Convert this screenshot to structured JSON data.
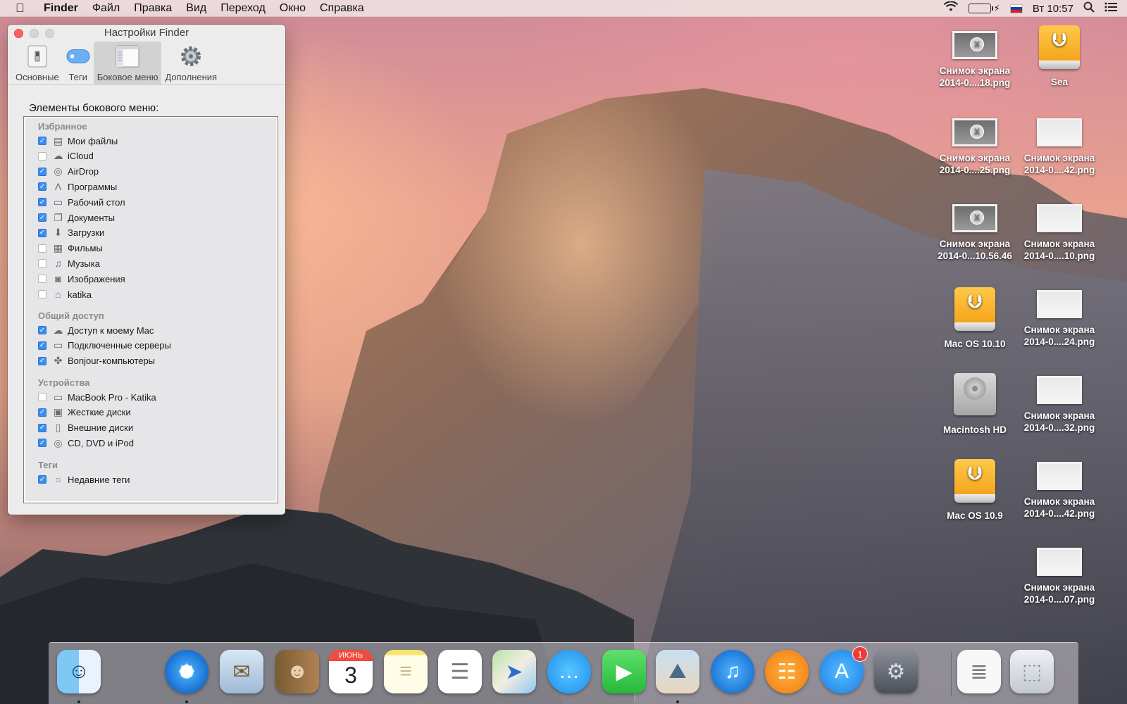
{
  "menubar": {
    "apple_icon": "apple-logo-icon",
    "app_name": "Finder",
    "items": [
      "Файл",
      "Правка",
      "Вид",
      "Переход",
      "Окно",
      "Справка"
    ],
    "clock": "Вт 10:57",
    "battery_level": 0.8,
    "status_icons": [
      "wifi-icon",
      "battery-icon",
      "language-flag-icon",
      "spotlight-icon",
      "notification-center-icon"
    ]
  },
  "prefs_window": {
    "title": "Настройки Finder",
    "tabs": [
      {
        "label": "Основные",
        "icon": "switch-icon"
      },
      {
        "label": "Теги",
        "icon": "tag-icon"
      },
      {
        "label": "Боковое меню",
        "icon": "sidebar-icon"
      },
      {
        "label": "Дополнения",
        "icon": "gear-icon"
      }
    ],
    "active_tab": "Боковое меню",
    "section_title": "Элементы бокового меню:",
    "groups": [
      {
        "header": "Избранное",
        "items": [
          {
            "label": "Мои файлы",
            "checked": true,
            "icon": "all-files-icon"
          },
          {
            "label": "iCloud",
            "checked": false,
            "icon": "cloud-icon"
          },
          {
            "label": "AirDrop",
            "checked": true,
            "icon": "airdrop-icon"
          },
          {
            "label": "Программы",
            "checked": true,
            "icon": "applications-icon"
          },
          {
            "label": "Рабочий стол",
            "checked": true,
            "icon": "desktop-icon"
          },
          {
            "label": "Документы",
            "checked": true,
            "icon": "documents-icon"
          },
          {
            "label": "Загрузки",
            "checked": true,
            "icon": "downloads-icon"
          },
          {
            "label": "Фильмы",
            "checked": false,
            "icon": "movies-icon"
          },
          {
            "label": "Музыка",
            "checked": false,
            "icon": "music-icon"
          },
          {
            "label": "Изображения",
            "checked": false,
            "icon": "camera-icon"
          },
          {
            "label": "katika",
            "checked": false,
            "icon": "home-icon"
          }
        ]
      },
      {
        "header": "Общий доступ",
        "items": [
          {
            "label": "Доступ к моему Mac",
            "checked": true,
            "icon": "cloud-icon"
          },
          {
            "label": "Подключенные серверы",
            "checked": true,
            "icon": "server-icon"
          },
          {
            "label": "Bonjour-компьютеры",
            "checked": true,
            "icon": "bonjour-icon"
          }
        ]
      },
      {
        "header": "Устройства",
        "items": [
          {
            "label": "MacBook Pro - Katika",
            "checked": false,
            "icon": "laptop-icon"
          },
          {
            "label": "Жесткие диски",
            "checked": true,
            "icon": "hard-disk-icon"
          },
          {
            "label": "Внешние диски",
            "checked": true,
            "icon": "external-disk-icon"
          },
          {
            "label": "CD, DVD и iPod",
            "checked": true,
            "icon": "optical-disc-icon"
          }
        ]
      },
      {
        "header": "Теги",
        "items": [
          {
            "label": "Недавние теги",
            "checked": true,
            "icon": "tag-circle-icon"
          }
        ]
      }
    ]
  },
  "desktop_icons": [
    {
      "line1": "Снимок экрана",
      "line2": "2014-0....18.png",
      "kind": "screenshot"
    },
    {
      "line1": "Sea",
      "line2": "",
      "kind": "usb-drive"
    },
    {
      "line1": "Снимок экрана",
      "line2": "2014-0....25.png",
      "kind": "screenshot"
    },
    {
      "line1": "Снимок экрана",
      "line2": "2014-0....42.png",
      "kind": "screenshot"
    },
    {
      "line1": "Снимок экрана",
      "line2": "2014-0...10.56.46",
      "kind": "screenshot"
    },
    {
      "line1": "Снимок экрана",
      "line2": "2014-0....10.png",
      "kind": "screenshot"
    },
    {
      "line1": "Mac OS 10.10",
      "line2": "",
      "kind": "usb-drive"
    },
    {
      "line1": "Снимок экрана",
      "line2": "2014-0....24.png",
      "kind": "screenshot"
    },
    {
      "line1": "Macintosh HD",
      "line2": "",
      "kind": "hard-disk"
    },
    {
      "line1": "Снимок экрана",
      "line2": "2014-0....32.png",
      "kind": "screenshot"
    },
    {
      "line1": "Mac OS 10.9",
      "line2": "",
      "kind": "usb-drive"
    },
    {
      "line1": "Снимок экрана",
      "line2": "2014-0....42.png",
      "kind": "screenshot"
    },
    {
      "line1": "Снимок экрана",
      "line2": "2014-0....07.png",
      "kind": "screenshot"
    }
  ],
  "dock": {
    "apps": [
      {
        "name": "finder-icon",
        "running": true
      },
      {
        "name": "safari-icon",
        "running": true
      },
      {
        "name": "mail-icon",
        "running": false
      },
      {
        "name": "contacts-icon",
        "running": false
      },
      {
        "name": "calendar-icon",
        "running": false,
        "month": "ИЮНЬ",
        "day": "3"
      },
      {
        "name": "notes-icon",
        "running": false
      },
      {
        "name": "reminders-icon",
        "running": false
      },
      {
        "name": "maps-icon",
        "running": false
      },
      {
        "name": "messages-icon",
        "running": false
      },
      {
        "name": "facetime-icon",
        "running": false
      },
      {
        "name": "iphoto-icon",
        "running": true
      },
      {
        "name": "itunes-icon",
        "running": false
      },
      {
        "name": "ibooks-icon",
        "running": false
      },
      {
        "name": "app-store-icon",
        "running": false,
        "badge": "1"
      },
      {
        "name": "system-preferences-icon",
        "running": false
      },
      {
        "name": "preview-document-icon",
        "running": false
      },
      {
        "name": "trash-icon",
        "running": false
      }
    ]
  },
  "colors": {
    "checkbox_on": "#3b8eef",
    "close_button": "#fc615d",
    "badge": "#ef3b34"
  }
}
